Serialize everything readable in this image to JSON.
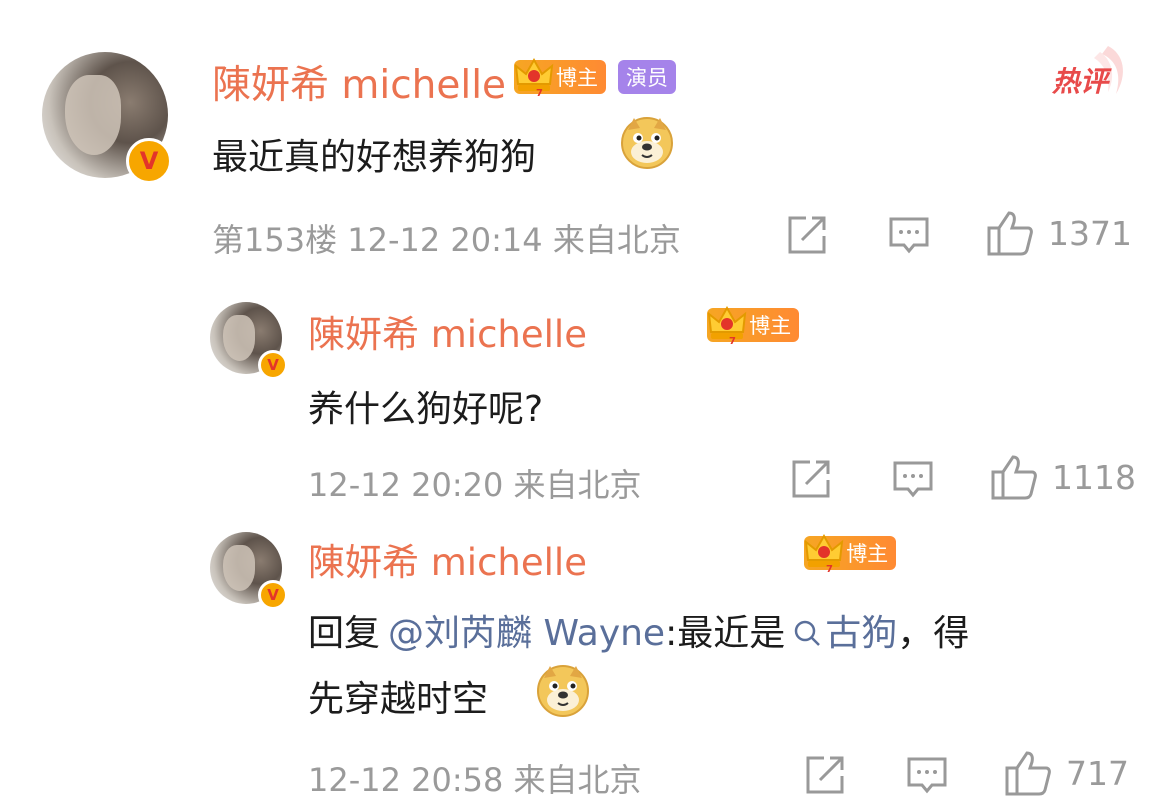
{
  "badge_hot": "热评",
  "comments": [
    {
      "name": "陳妍希 michelle",
      "tags": [
        "博主",
        "演员"
      ],
      "text": "最近真的好想养狗狗",
      "floor": "第153楼",
      "time": "12-12 20:14",
      "location": "来自北京",
      "likes": "1371"
    },
    {
      "name": "陳妍希 michelle",
      "tags": [
        "博主"
      ],
      "text": "养什么狗好呢?",
      "time": "12-12 20:20",
      "location": "来自北京",
      "likes": "1118"
    },
    {
      "name": "陳妍希 michelle",
      "tags": [
        "博主"
      ],
      "reply_prefix": "回复",
      "reply_mention": "@刘芮麟 Wayne",
      "reply_colon": ":最近是",
      "reply_topic": "古狗",
      "reply_after": "，得",
      "reply_line2": "先穿越时空",
      "time": "12-12 20:58",
      "location": "来自北京",
      "likes": "717"
    }
  ],
  "icons": {
    "repost": "repost-icon",
    "comment": "comment-icon",
    "like": "thumbs-up-icon",
    "emoji": "doge-emoji",
    "search": "search-icon",
    "verified": "verified-v-icon",
    "crown": "crown-icon"
  },
  "colors": {
    "name": "#eb7350",
    "link": "#5a6f9a",
    "meta": "#9a9a9a",
    "actor_tag": "#a583ea",
    "blogger_tag": "#f6a623"
  }
}
